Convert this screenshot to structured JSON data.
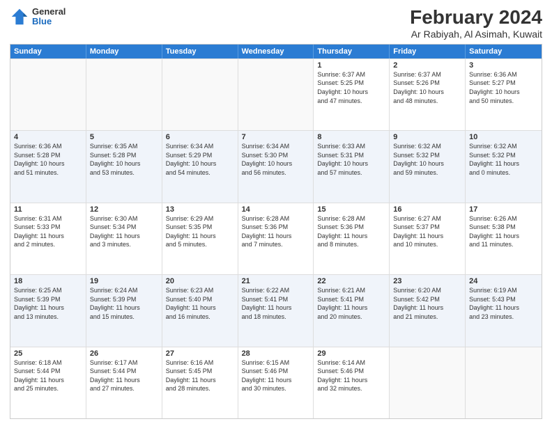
{
  "logo": {
    "general": "General",
    "blue": "Blue"
  },
  "title": "February 2024",
  "subtitle": "Ar Rabiyah, Al Asimah, Kuwait",
  "header_days": [
    "Sunday",
    "Monday",
    "Tuesday",
    "Wednesday",
    "Thursday",
    "Friday",
    "Saturday"
  ],
  "weeks": [
    [
      {
        "day": "",
        "info": "",
        "empty": true
      },
      {
        "day": "",
        "info": "",
        "empty": true
      },
      {
        "day": "",
        "info": "",
        "empty": true
      },
      {
        "day": "",
        "info": "",
        "empty": true
      },
      {
        "day": "1",
        "info": "Sunrise: 6:37 AM\nSunset: 5:25 PM\nDaylight: 10 hours\nand 47 minutes.",
        "empty": false
      },
      {
        "day": "2",
        "info": "Sunrise: 6:37 AM\nSunset: 5:26 PM\nDaylight: 10 hours\nand 48 minutes.",
        "empty": false
      },
      {
        "day": "3",
        "info": "Sunrise: 6:36 AM\nSunset: 5:27 PM\nDaylight: 10 hours\nand 50 minutes.",
        "empty": false
      }
    ],
    [
      {
        "day": "4",
        "info": "Sunrise: 6:36 AM\nSunset: 5:28 PM\nDaylight: 10 hours\nand 51 minutes.",
        "empty": false
      },
      {
        "day": "5",
        "info": "Sunrise: 6:35 AM\nSunset: 5:28 PM\nDaylight: 10 hours\nand 53 minutes.",
        "empty": false
      },
      {
        "day": "6",
        "info": "Sunrise: 6:34 AM\nSunset: 5:29 PM\nDaylight: 10 hours\nand 54 minutes.",
        "empty": false
      },
      {
        "day": "7",
        "info": "Sunrise: 6:34 AM\nSunset: 5:30 PM\nDaylight: 10 hours\nand 56 minutes.",
        "empty": false
      },
      {
        "day": "8",
        "info": "Sunrise: 6:33 AM\nSunset: 5:31 PM\nDaylight: 10 hours\nand 57 minutes.",
        "empty": false
      },
      {
        "day": "9",
        "info": "Sunrise: 6:32 AM\nSunset: 5:32 PM\nDaylight: 10 hours\nand 59 minutes.",
        "empty": false
      },
      {
        "day": "10",
        "info": "Sunrise: 6:32 AM\nSunset: 5:32 PM\nDaylight: 11 hours\nand 0 minutes.",
        "empty": false
      }
    ],
    [
      {
        "day": "11",
        "info": "Sunrise: 6:31 AM\nSunset: 5:33 PM\nDaylight: 11 hours\nand 2 minutes.",
        "empty": false
      },
      {
        "day": "12",
        "info": "Sunrise: 6:30 AM\nSunset: 5:34 PM\nDaylight: 11 hours\nand 3 minutes.",
        "empty": false
      },
      {
        "day": "13",
        "info": "Sunrise: 6:29 AM\nSunset: 5:35 PM\nDaylight: 11 hours\nand 5 minutes.",
        "empty": false
      },
      {
        "day": "14",
        "info": "Sunrise: 6:28 AM\nSunset: 5:36 PM\nDaylight: 11 hours\nand 7 minutes.",
        "empty": false
      },
      {
        "day": "15",
        "info": "Sunrise: 6:28 AM\nSunset: 5:36 PM\nDaylight: 11 hours\nand 8 minutes.",
        "empty": false
      },
      {
        "day": "16",
        "info": "Sunrise: 6:27 AM\nSunset: 5:37 PM\nDaylight: 11 hours\nand 10 minutes.",
        "empty": false
      },
      {
        "day": "17",
        "info": "Sunrise: 6:26 AM\nSunset: 5:38 PM\nDaylight: 11 hours\nand 11 minutes.",
        "empty": false
      }
    ],
    [
      {
        "day": "18",
        "info": "Sunrise: 6:25 AM\nSunset: 5:39 PM\nDaylight: 11 hours\nand 13 minutes.",
        "empty": false
      },
      {
        "day": "19",
        "info": "Sunrise: 6:24 AM\nSunset: 5:39 PM\nDaylight: 11 hours\nand 15 minutes.",
        "empty": false
      },
      {
        "day": "20",
        "info": "Sunrise: 6:23 AM\nSunset: 5:40 PM\nDaylight: 11 hours\nand 16 minutes.",
        "empty": false
      },
      {
        "day": "21",
        "info": "Sunrise: 6:22 AM\nSunset: 5:41 PM\nDaylight: 11 hours\nand 18 minutes.",
        "empty": false
      },
      {
        "day": "22",
        "info": "Sunrise: 6:21 AM\nSunset: 5:41 PM\nDaylight: 11 hours\nand 20 minutes.",
        "empty": false
      },
      {
        "day": "23",
        "info": "Sunrise: 6:20 AM\nSunset: 5:42 PM\nDaylight: 11 hours\nand 21 minutes.",
        "empty": false
      },
      {
        "day": "24",
        "info": "Sunrise: 6:19 AM\nSunset: 5:43 PM\nDaylight: 11 hours\nand 23 minutes.",
        "empty": false
      }
    ],
    [
      {
        "day": "25",
        "info": "Sunrise: 6:18 AM\nSunset: 5:44 PM\nDaylight: 11 hours\nand 25 minutes.",
        "empty": false
      },
      {
        "day": "26",
        "info": "Sunrise: 6:17 AM\nSunset: 5:44 PM\nDaylight: 11 hours\nand 27 minutes.",
        "empty": false
      },
      {
        "day": "27",
        "info": "Sunrise: 6:16 AM\nSunset: 5:45 PM\nDaylight: 11 hours\nand 28 minutes.",
        "empty": false
      },
      {
        "day": "28",
        "info": "Sunrise: 6:15 AM\nSunset: 5:46 PM\nDaylight: 11 hours\nand 30 minutes.",
        "empty": false
      },
      {
        "day": "29",
        "info": "Sunrise: 6:14 AM\nSunset: 5:46 PM\nDaylight: 11 hours\nand 32 minutes.",
        "empty": false
      },
      {
        "day": "",
        "info": "",
        "empty": true
      },
      {
        "day": "",
        "info": "",
        "empty": true
      }
    ]
  ]
}
